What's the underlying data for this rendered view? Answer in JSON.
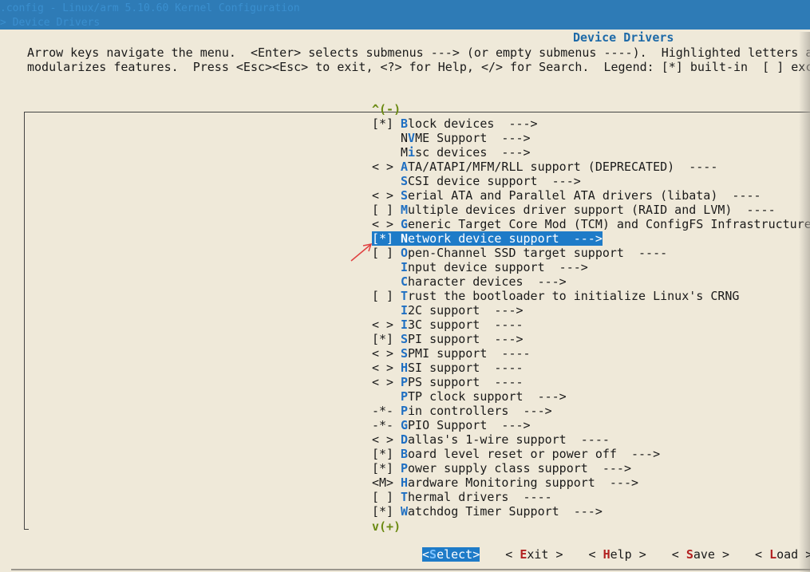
{
  "header": {
    "line1": ".config - Linux/arm 5.10.60 Kernel Configuration",
    "line2": "> Device Drivers"
  },
  "dialog": {
    "title": "Device Drivers",
    "help_line1": "Arrow keys navigate the menu.  <Enter> selects submenus ---> (or empty submenus ----).  Highlighted letters a",
    "help_line2": "modularizes features.  Press <Esc><Esc> to exit, <?> for Help, </> for Search.  Legend: [*] built-in  [ ] exc",
    "scroll_up": "^(-)",
    "scroll_down": "v(+)"
  },
  "menu": [
    {
      "prefix": "[*]",
      "hot": "B",
      "rest": "lock devices  --->",
      "selected": false
    },
    {
      "prefix": "",
      "lead": "N",
      "hot": "V",
      "rest": "ME Support  --->",
      "selected": false
    },
    {
      "prefix": "",
      "lead": "M",
      "hot": "i",
      "rest": "sc devices  --->",
      "selected": false
    },
    {
      "prefix": "< >",
      "hot": "A",
      "rest": "TA/ATAPI/MFM/RLL support (DEPRECATED)  ----",
      "selected": false
    },
    {
      "prefix": "",
      "hot": "S",
      "rest": "CSI device support  --->",
      "selected": false
    },
    {
      "prefix": "< >",
      "hot": "S",
      "rest": "erial ATA and Parallel ATA drivers (libata)  ----",
      "selected": false
    },
    {
      "prefix": "[ ]",
      "hot": "M",
      "rest": "ultiple devices driver support (RAID and LVM)  ----",
      "selected": false
    },
    {
      "prefix": "< >",
      "hot": "G",
      "rest": "eneric Target Core Mod (TCM) and ConfigFS Infrastructure",
      "selected": false
    },
    {
      "prefix": "[*]",
      "hot": "N",
      "rest": "etwork device support  --->",
      "selected": true
    },
    {
      "prefix": "[ ]",
      "hot": "O",
      "rest": "pen-Channel SSD target support  ----",
      "selected": false
    },
    {
      "prefix": "",
      "hot": "I",
      "rest": "nput device support  --->",
      "selected": false
    },
    {
      "prefix": "",
      "hot": "C",
      "rest": "haracter devices  --->",
      "selected": false
    },
    {
      "prefix": "[ ]",
      "hot": "T",
      "rest": "rust the bootloader to initialize Linux's CRNG",
      "selected": false
    },
    {
      "prefix": "",
      "hot": "I",
      "rest": "2C support  --->",
      "selected": false
    },
    {
      "prefix": "< >",
      "hot": "I",
      "rest": "3C support  ----",
      "selected": false
    },
    {
      "prefix": "[*]",
      "hot": "S",
      "rest": "PI support  --->",
      "selected": false
    },
    {
      "prefix": "< >",
      "hot": "S",
      "rest": "PMI support  ----",
      "selected": false
    },
    {
      "prefix": "< >",
      "hot": "H",
      "rest": "SI support  ----",
      "selected": false
    },
    {
      "prefix": "< >",
      "hot": "P",
      "rest": "PS support  ----",
      "selected": false
    },
    {
      "prefix": "",
      "hot": "P",
      "rest": "TP clock support  --->",
      "selected": false
    },
    {
      "prefix": "-*-",
      "hot": "P",
      "rest": "in controllers  --->",
      "selected": false
    },
    {
      "prefix": "-*-",
      "hot": "G",
      "rest": "PIO Support  --->",
      "selected": false
    },
    {
      "prefix": "< >",
      "hot": "D",
      "rest": "allas's 1-wire support  ----",
      "selected": false
    },
    {
      "prefix": "[*]",
      "hot": "B",
      "rest": "oard level reset or power off  --->",
      "selected": false
    },
    {
      "prefix": "[*]",
      "hot": "P",
      "rest": "ower supply class support  --->",
      "selected": false
    },
    {
      "prefix": "<M>",
      "hot": "H",
      "rest": "ardware Monitoring support  --->",
      "selected": false
    },
    {
      "prefix": "[ ]",
      "hot": "T",
      "rest": "hermal drivers  ----",
      "selected": false
    },
    {
      "prefix": "[*]",
      "hot": "W",
      "rest": "atchdog Timer Support  --->",
      "selected": false
    }
  ],
  "buttons": [
    {
      "open": "<",
      "hot": "S",
      "rest": "elect",
      "close": ">",
      "active": true,
      "name": "select-button"
    },
    {
      "open": "< ",
      "hot": "E",
      "rest": "xit",
      "close": " >",
      "active": false,
      "name": "exit-button"
    },
    {
      "open": "< ",
      "hot": "H",
      "rest": "elp",
      "close": " >",
      "active": false,
      "name": "help-button"
    },
    {
      "open": "< ",
      "hot": "S",
      "rest": "ave",
      "close": " >",
      "active": false,
      "name": "save-button"
    },
    {
      "open": "< ",
      "hot": "L",
      "rest": "oad",
      "close": " >",
      "active": false,
      "name": "load-button"
    }
  ],
  "colors": {
    "background": "#efe9d9",
    "titlebar": "#2e7bb6",
    "selection": "#1e7bc8",
    "hotkey": "#1f6fc2",
    "annotation_arrow": "#e04040"
  }
}
